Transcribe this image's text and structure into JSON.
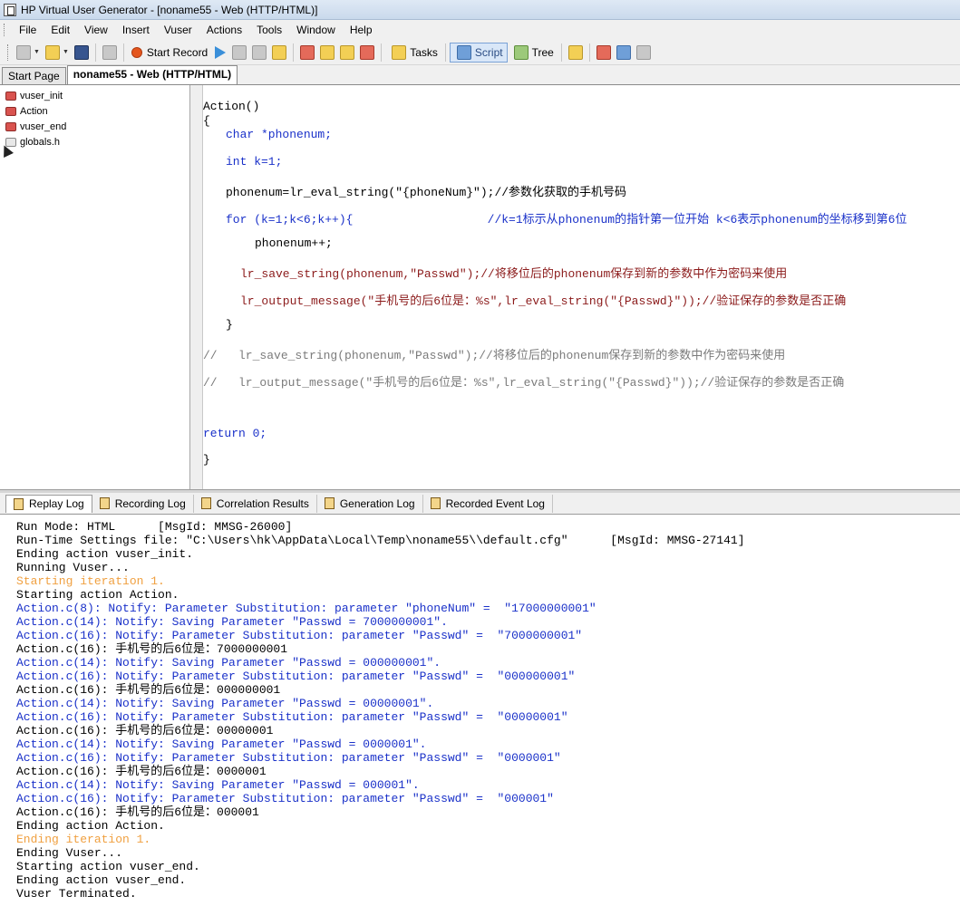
{
  "window": {
    "title": "HP Virtual User Generator - [noname55 - Web (HTTP/HTML)]"
  },
  "menu": [
    "File",
    "Edit",
    "View",
    "Insert",
    "Vuser",
    "Actions",
    "Tools",
    "Window",
    "Help"
  ],
  "toolbar": {
    "start_record": "Start Record",
    "tasks": "Tasks",
    "script": "Script",
    "tree": "Tree"
  },
  "doc_tabs": [
    "Start Page",
    "noname55 - Web (HTTP/HTML)"
  ],
  "tree_items": [
    {
      "label": "vuser_init",
      "icon": "action-icon"
    },
    {
      "label": "Action",
      "icon": "action-icon"
    },
    {
      "label": "vuser_end",
      "icon": "action-icon"
    },
    {
      "label": "globals.h",
      "icon": "header-file-icon"
    }
  ],
  "code": [
    "Action()",
    "{",
    "char *phonenum;",
    "int k=1;",
    "phonenum=lr_eval_string(\"{phoneNum}\");//参数化获取的手机号码",
    "for (k=1;k<6;k++){                   //k=1标示从phonenum的指针第一位开始 k<6表示phonenum的坐标移到第6位",
    "phonenum++;",
    "lr_save_string(phonenum,\"Passwd\");//将移位后的phonenum保存到新的参数中作为密码来使用",
    "lr_output_message(\"手机号的后6位是：%s\",lr_eval_string(\"{Passwd}\"));//验证保存的参数是否正确",
    "}",
    "//   lr_save_string(phonenum,\"Passwd\");//将移位后的phonenum保存到新的参数中作为密码来使用",
    "//   lr_output_message(\"手机号的后6位是：%s\",lr_eval_string(\"{Passwd}\"));//验证保存的参数是否正确",
    "return 0;",
    "}"
  ],
  "output_tabs": [
    "Replay Log",
    "Recording Log",
    "Correlation Results",
    "Generation Log",
    "Recorded Event Log"
  ],
  "log": [
    {
      "text": "Run Mode: HTML      [MsgId: MMSG-26000]",
      "style": "black"
    },
    {
      "text": "Run-Time Settings file: \"C:\\Users\\hk\\AppData\\Local\\Temp\\noname55\\\\default.cfg\"      [MsgId: MMSG-27141]",
      "style": "black"
    },
    {
      "text": "Ending action vuser_init.",
      "style": "black"
    },
    {
      "text": "Running Vuser...",
      "style": "black"
    },
    {
      "text": "Starting iteration 1.",
      "style": "orange"
    },
    {
      "text": "Starting action Action.",
      "style": "black"
    },
    {
      "text": "Action.c(8): Notify: Parameter Substitution: parameter \"phoneNum\" =  \"17000000001\"",
      "style": "blue"
    },
    {
      "text": "Action.c(14): Notify: Saving Parameter \"Passwd = 7000000001\".",
      "style": "blue"
    },
    {
      "text": "Action.c(16): Notify: Parameter Substitution: parameter \"Passwd\" =  \"7000000001\"",
      "style": "blue"
    },
    {
      "text": "Action.c(16): 手机号的后6位是：7000000001",
      "style": "black"
    },
    {
      "text": "Action.c(14): Notify: Saving Parameter \"Passwd = 000000001\".",
      "style": "blue"
    },
    {
      "text": "Action.c(16): Notify: Parameter Substitution: parameter \"Passwd\" =  \"000000001\"",
      "style": "blue"
    },
    {
      "text": "Action.c(16): 手机号的后6位是：000000001",
      "style": "black"
    },
    {
      "text": "Action.c(14): Notify: Saving Parameter \"Passwd = 00000001\".",
      "style": "blue"
    },
    {
      "text": "Action.c(16): Notify: Parameter Substitution: parameter \"Passwd\" =  \"00000001\"",
      "style": "blue"
    },
    {
      "text": "Action.c(16): 手机号的后6位是：00000001",
      "style": "black"
    },
    {
      "text": "Action.c(14): Notify: Saving Parameter \"Passwd = 0000001\".",
      "style": "blue"
    },
    {
      "text": "Action.c(16): Notify: Parameter Substitution: parameter \"Passwd\" =  \"0000001\"",
      "style": "blue"
    },
    {
      "text": "Action.c(16): 手机号的后6位是：0000001",
      "style": "black"
    },
    {
      "text": "Action.c(14): Notify: Saving Parameter \"Passwd = 000001\".",
      "style": "blue"
    },
    {
      "text": "Action.c(16): Notify: Parameter Substitution: parameter \"Passwd\" =  \"000001\"",
      "style": "blue"
    },
    {
      "text": "Action.c(16): 手机号的后6位是：000001",
      "style": "black"
    },
    {
      "text": "Ending action Action.",
      "style": "black"
    },
    {
      "text": "Ending iteration 1.",
      "style": "orange"
    },
    {
      "text": "Ending Vuser...",
      "style": "black"
    },
    {
      "text": "Starting action vuser_end.",
      "style": "black"
    },
    {
      "text": "Ending action vuser_end.",
      "style": "black"
    },
    {
      "text": "Vuser Terminated.",
      "style": "black"
    }
  ],
  "colors": {
    "keyword": "#1a31c9",
    "string": "#1a31c9",
    "comment": "#7b7b7b",
    "log_notify": "#1a31c9",
    "log_iteration": "#f0a040"
  }
}
